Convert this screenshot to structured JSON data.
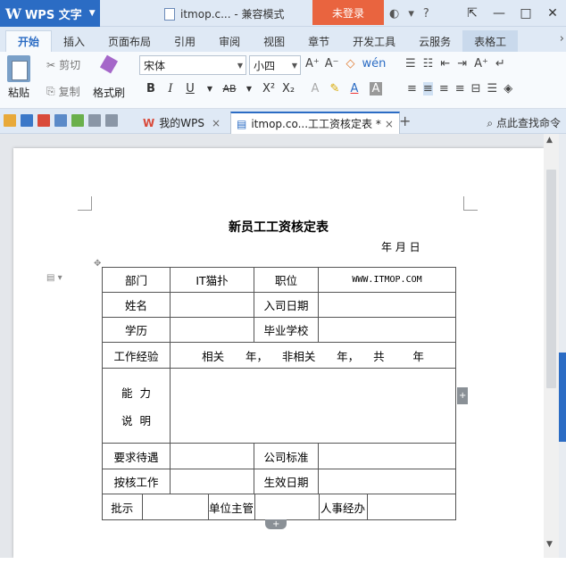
{
  "app": {
    "logo_mark": "W",
    "name": "WPS 文字",
    "login": "未登录"
  },
  "window": {
    "doc_title": "itmop.c... - 兼容模式"
  },
  "ribbon_tabs": [
    "开始",
    "插入",
    "页面布局",
    "引用",
    "审阅",
    "视图",
    "章节",
    "开发工具",
    "云服务",
    "表格工"
  ],
  "ribbon": {
    "paste": "粘贴",
    "cut": "剪切",
    "copy": "复制",
    "format_painter": "格式刷",
    "font_name": "宋体",
    "font_size": "小四",
    "bold": "B",
    "italic": "I",
    "underline": "U",
    "strike": "AB",
    "superscript": "X²",
    "subscript": "X₂"
  },
  "doc_tabs": [
    {
      "label": "我的WPS",
      "close": "×"
    },
    {
      "label": "itmop.co...工工资核定表 *",
      "close": "×"
    }
  ],
  "toolbar": {
    "add_tab": "+",
    "search_cmd": "点此查找命令"
  },
  "accent_color": "#2b6cc4",
  "login_color": "#e9643f",
  "document": {
    "title": "新员工工资核定表",
    "date": "年      月    日",
    "table": {
      "r1": [
        "部门",
        "IT猫扑",
        "职位",
        "WWW.ITMOP.COM"
      ],
      "r2": [
        "姓名",
        "",
        "入司日期",
        ""
      ],
      "r3": [
        "学历",
        "",
        "毕业学校",
        ""
      ],
      "r4": [
        "工作经验",
        "相关      年，    非相关      年，    共        年"
      ],
      "r5": [
        "能  力",
        "说  明"
      ],
      "r6": [
        "要求待遇",
        "",
        "公司标准",
        ""
      ],
      "r7": [
        "按核工作",
        "",
        "生效日期",
        ""
      ],
      "r8": [
        "批示",
        "",
        "单位主管",
        "",
        "人事经办",
        ""
      ]
    }
  }
}
